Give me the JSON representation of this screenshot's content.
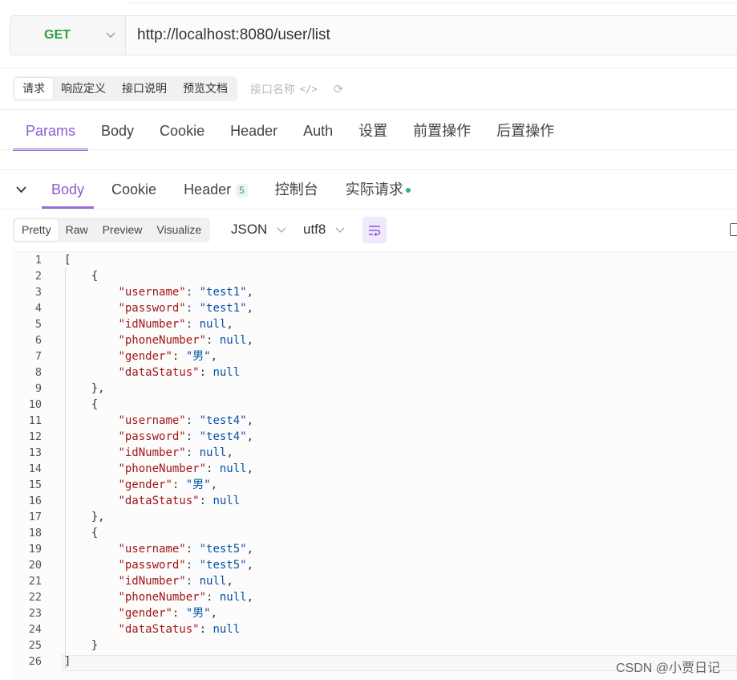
{
  "request": {
    "method": "GET",
    "url": "http://localhost:8080/user/list"
  },
  "doc_tabs": [
    "请求",
    "响应定义",
    "接口说明",
    "预览文档"
  ],
  "doc_name_placeholder": "接口名称",
  "request_tabs": [
    "Params",
    "Body",
    "Cookie",
    "Header",
    "Auth",
    "设置",
    "前置操作",
    "后置操作"
  ],
  "response_tabs": {
    "body": "Body",
    "cookie": "Cookie",
    "header": "Header",
    "header_count": "5",
    "console": "控制台",
    "actual_request": "实际请求"
  },
  "view_modes": [
    "Pretty",
    "Raw",
    "Preview",
    "Visualize"
  ],
  "format": "JSON",
  "encoding": "utf8",
  "code_lines": [
    "[",
    "    {",
    "        \"username\": \"test1\",",
    "        \"password\": \"test1\",",
    "        \"idNumber\": null,",
    "        \"phoneNumber\": null,",
    "        \"gender\": \"男\",",
    "        \"dataStatus\": null",
    "    },",
    "    {",
    "        \"username\": \"test4\",",
    "        \"password\": \"test4\",",
    "        \"idNumber\": null,",
    "        \"phoneNumber\": null,",
    "        \"gender\": \"男\",",
    "        \"dataStatus\": null",
    "    },",
    "    {",
    "        \"username\": \"test5\",",
    "        \"password\": \"test5\",",
    "        \"idNumber\": null,",
    "        \"phoneNumber\": null,",
    "        \"gender\": \"男\",",
    "        \"dataStatus\": null",
    "    }",
    "]"
  ],
  "watermark": "CSDN @小贾日记",
  "colors": {
    "accent": "#8e59d6",
    "method_get": "#2f9e44",
    "json_key": "#a31515",
    "json_value": "#0451a5"
  }
}
